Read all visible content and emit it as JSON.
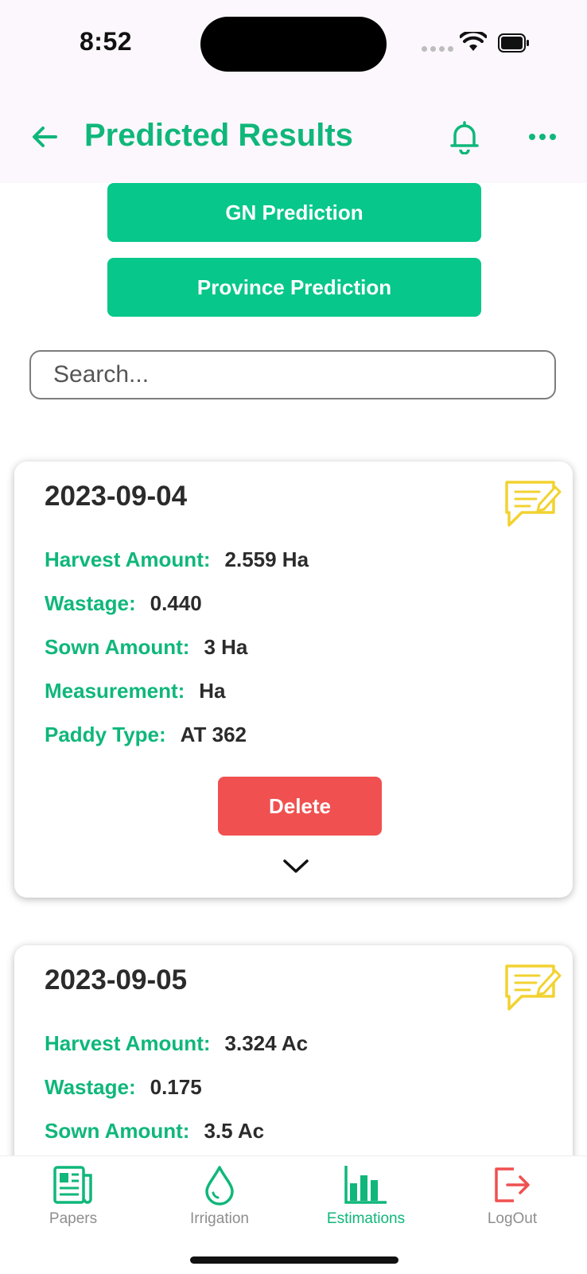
{
  "status": {
    "time": "8:52"
  },
  "header": {
    "title": "Predicted Results"
  },
  "actions": {
    "gn_prediction": "GN Prediction",
    "province_prediction": "Province Prediction"
  },
  "search": {
    "placeholder": "Search...",
    "value": ""
  },
  "cards": [
    {
      "date": "2023-09-04",
      "fields": [
        {
          "label": "Harvest Amount:",
          "value": "2.559 Ha"
        },
        {
          "label": "Wastage:",
          "value": "0.440"
        },
        {
          "label": "Sown Amount:",
          "value": "3 Ha"
        },
        {
          "label": "Measurement:",
          "value": "Ha"
        },
        {
          "label": "Paddy Type:",
          "value": "AT 362"
        }
      ],
      "delete_label": "Delete"
    },
    {
      "date": "2023-09-05",
      "fields": [
        {
          "label": "Harvest Amount:",
          "value": "3.324 Ac"
        },
        {
          "label": "Wastage:",
          "value": "0.175"
        },
        {
          "label": "Sown Amount:",
          "value": "3.5 Ac"
        }
      ]
    }
  ],
  "bottom_nav": {
    "items": [
      {
        "label": "Papers",
        "icon": "newspaper-icon"
      },
      {
        "label": "Irrigation",
        "icon": "water-drop-icon"
      },
      {
        "label": "Estimations",
        "icon": "bar-chart-icon",
        "active": true
      },
      {
        "label": "LogOut",
        "icon": "logout-icon"
      }
    ]
  },
  "colors": {
    "brand_green": "#07c78a",
    "text_green": "#0fb77a",
    "delete_red": "#f05050",
    "note_yellow": "#f2d230"
  }
}
